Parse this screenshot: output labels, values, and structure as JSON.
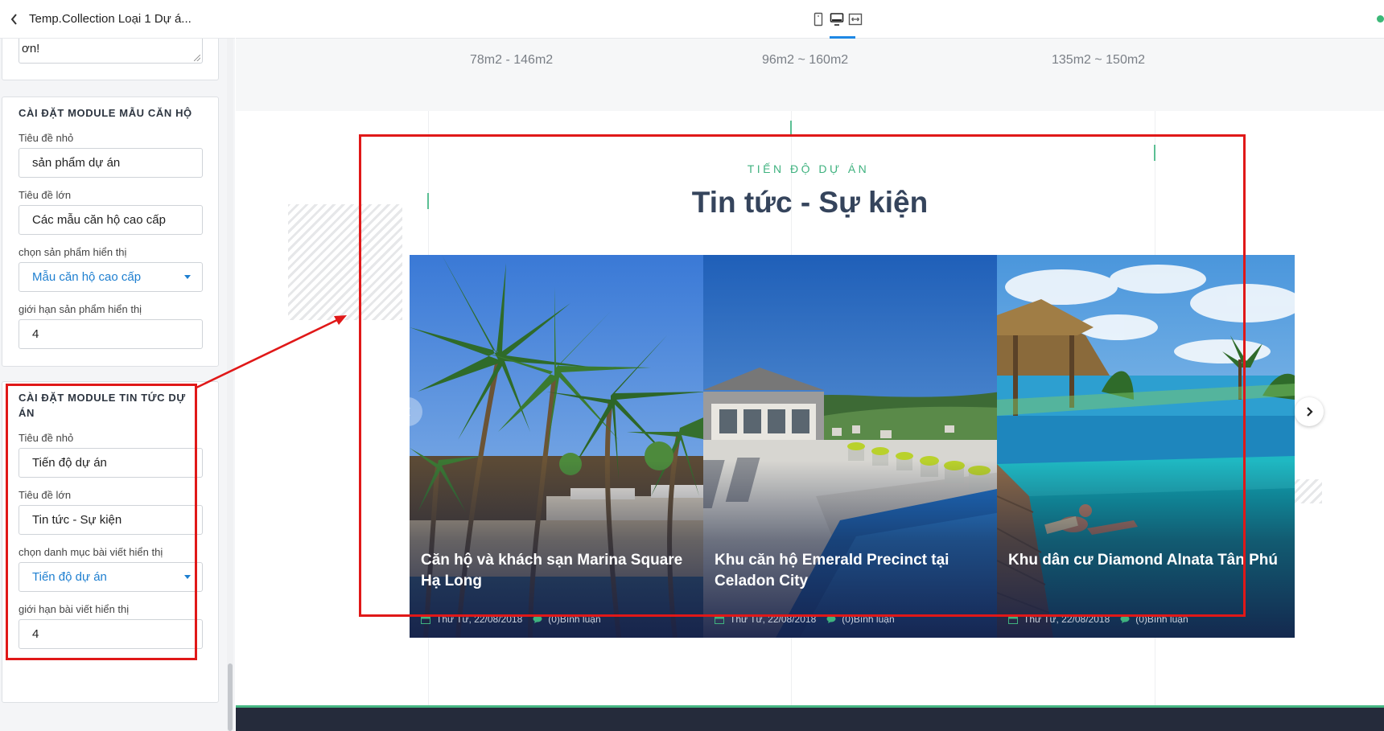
{
  "sidebar": {
    "title": "Temp.Collection Loại 1 Dự á...",
    "prev_textarea_value": "ơn!",
    "apartment_module": {
      "heading": "CÀI ĐẶT MODULE MẪU CĂN HỘ",
      "small_title_label": "Tiêu đề nhỏ",
      "small_title_value": "sản phẩm dự án",
      "big_title_label": "Tiêu đề lớn",
      "big_title_value": "Các mẫu căn hộ cao cấp",
      "product_select_label": "chọn sản phẩm hiển thị",
      "product_select_value": "Mẫu căn hộ cao cấp",
      "limit_label": "giới hạn sản phẩm hiển thị",
      "limit_value": "4"
    },
    "news_module": {
      "heading": "CÀI ĐẶT MODULE TIN TỨC DỰ ÁN",
      "small_title_label": "Tiêu đề nhỏ",
      "small_title_value": "Tiến độ dự án",
      "big_title_label": "Tiêu đề lớn",
      "big_title_value": "Tin tức - Sự kiện",
      "category_select_label": "chọn danh mục bài viết hiển thị",
      "category_select_value": "Tiến độ dự án",
      "limit_label": "giới hạn bài viết hiển thị",
      "limit_value": "4"
    }
  },
  "toolbar": {
    "icons": [
      "mobile-view-icon",
      "desktop-view-icon",
      "fullwidth-view-icon"
    ],
    "active_view": "desktop",
    "accent_color": "#1e88e5"
  },
  "preview": {
    "sizes": [
      "78m2 - 146m2",
      "96m2 ~ 160m2",
      "135m2 ~ 150m2"
    ],
    "section_eyebrow": "TIẾN ĐỘ DỰ ÁN",
    "section_title": "Tin tức - Sự kiện",
    "news": [
      {
        "title": "Căn hộ và khách sạn Marina Square Hạ Long",
        "date": "Thứ Tư, 22/08/2018",
        "comments": "(0)Bình luận"
      },
      {
        "title": "Khu căn hộ Emerald Precinct tại Celadon City",
        "date": "Thứ Tư, 22/08/2018",
        "comments": "(0)Bình luận"
      },
      {
        "title": "Khu dân cư Diamond Alnata Tân Phú",
        "date": "Thứ Tư, 22/08/2018",
        "comments": "(0)Bình luận"
      }
    ],
    "accent_color": "#3fb27f",
    "title_color": "#35445c"
  },
  "annotation_color": "#e01818"
}
